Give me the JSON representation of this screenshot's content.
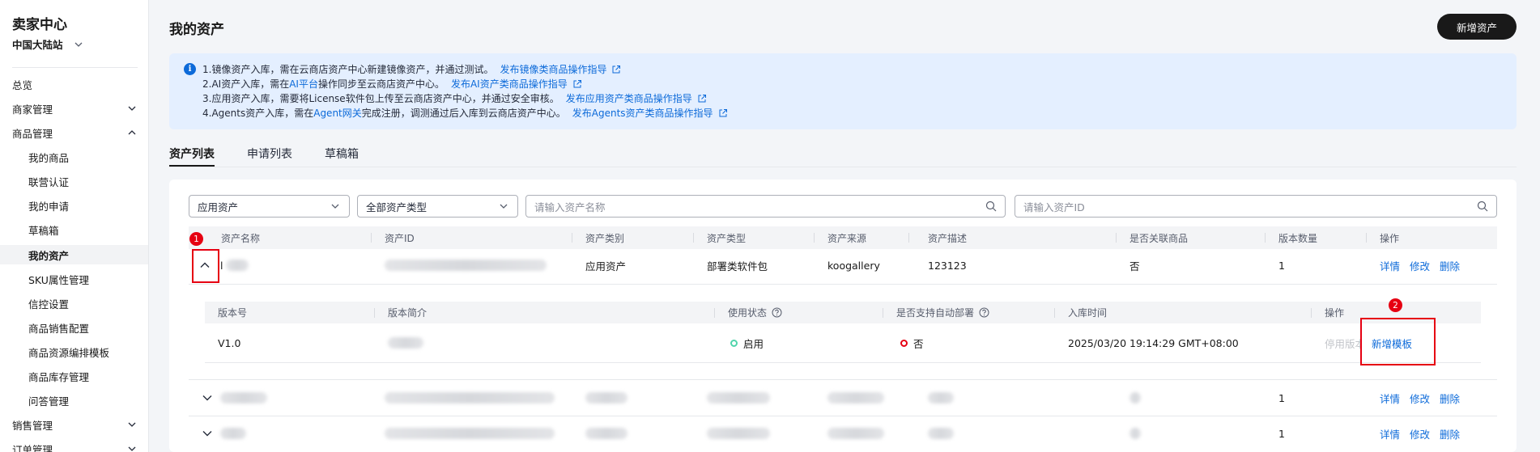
{
  "sidebar": {
    "title": "卖家中心",
    "region": "中国大陆站",
    "items": [
      {
        "label": "总览"
      },
      {
        "label": "商家管理"
      },
      {
        "label": "商品管理"
      },
      {
        "label": "我的商品"
      },
      {
        "label": "联营认证"
      },
      {
        "label": "我的申请"
      },
      {
        "label": "草稿箱"
      },
      {
        "label": "我的资产"
      },
      {
        "label": "SKU属性管理"
      },
      {
        "label": "信控设置"
      },
      {
        "label": "商品销售配置"
      },
      {
        "label": "商品资源编排模板"
      },
      {
        "label": "商品库存管理"
      },
      {
        "label": "问答管理"
      },
      {
        "label": "销售管理"
      },
      {
        "label": "订单管理"
      }
    ]
  },
  "header": {
    "title": "我的资产",
    "new_asset_label": "新增资产"
  },
  "notice": {
    "lines": [
      {
        "pre": "1.镜像资产入库，需在云商店资产中心新建镜像资产，并通过测试。",
        "link": "发布镜像类商品操作指导"
      },
      {
        "pre": "2.AI资产入库，需在",
        "inline_link": "AI平台",
        "mid": "操作同步至云商店资产中心。",
        "link": "发布AI资产类商品操作指导"
      },
      {
        "pre": "3.应用资产入库，需要将License软件包上传至云商店资产中心，并通过安全审核。",
        "link": "发布应用资产类商品操作指导"
      },
      {
        "pre": "4.Agents资产入库，需在",
        "inline_link": "Agent网关",
        "mid": "完成注册，调测通过后入库到云商店资产中心。",
        "link": "发布Agents资产类商品操作指导"
      }
    ]
  },
  "tabs": [
    {
      "label": "资产列表"
    },
    {
      "label": "申请列表"
    },
    {
      "label": "草稿箱"
    }
  ],
  "filters": {
    "asset_category": "应用资产",
    "asset_type": "全部资产类型",
    "name_placeholder": "请输入资产名称",
    "id_placeholder": "请输入资产ID"
  },
  "table": {
    "headers": [
      "资产名称",
      "资产ID",
      "资产类别",
      "资产类型",
      "资产来源",
      "资产描述",
      "是否关联商品",
      "版本数量",
      "操作"
    ],
    "rows": [
      {
        "name": "l",
        "category": "应用资产",
        "type": "部署类软件包",
        "source": "koogallery",
        "desc": "123123",
        "linked": "否",
        "versions": "1"
      },
      {
        "versions": "1"
      },
      {
        "versions": "1"
      }
    ],
    "actions": {
      "detail": "详情",
      "edit": "修改",
      "delete": "删除"
    }
  },
  "version_table": {
    "headers": [
      "版本号",
      "版本简介",
      "使用状态",
      "是否支持自动部署",
      "入库时间",
      "操作"
    ],
    "row": {
      "version": "V1.0",
      "status": "启用",
      "auto_deploy": "否",
      "time": "2025/03/20 19:14:29 GMT+08:00",
      "disable_label": "停用版本",
      "add_template_label": "新增模板"
    }
  },
  "callouts": [
    "1",
    "2"
  ],
  "colors": {
    "link": "#0c6ad9",
    "callout": "#e60012",
    "status_enabled": "#50d4ab",
    "status_no": "#e60012"
  }
}
